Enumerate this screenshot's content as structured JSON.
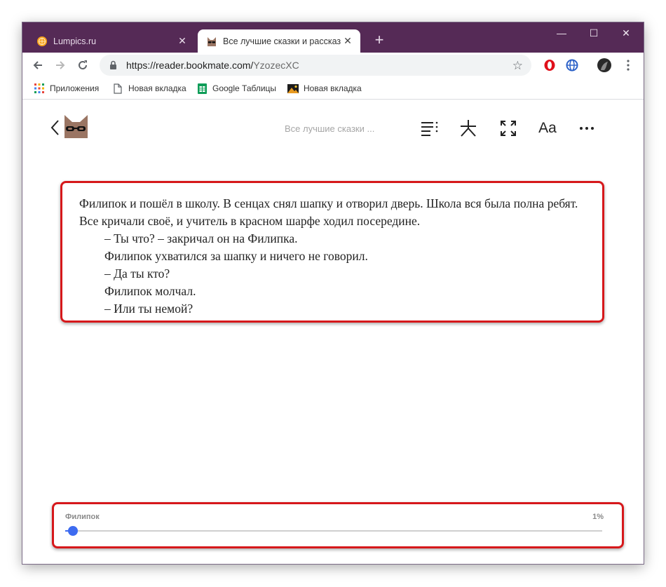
{
  "browser": {
    "tabs": [
      {
        "title": "Lumpics.ru",
        "favicon": "orange-icon",
        "active": false
      },
      {
        "title": "Все лучшие сказки и рассказы.",
        "favicon": "bookmate-cat-icon",
        "active": true
      }
    ],
    "url_host": "https://reader.bookmate.com/",
    "url_path": "YzozecXC",
    "bookmarks": [
      {
        "label": "Приложения",
        "icon": "apps-grid-icon"
      },
      {
        "label": "Новая вкладка",
        "icon": "page-icon"
      },
      {
        "label": "Google Таблицы",
        "icon": "sheets-icon"
      },
      {
        "label": "Новая вкладка",
        "icon": "image-icon"
      }
    ],
    "window_controls": {
      "minimize": "—",
      "maximize": "☐",
      "close": "✕"
    }
  },
  "reader": {
    "book_title": "Все лучшие сказки ...",
    "font_button_label": "Aa",
    "paragraphs": [
      {
        "text": "Филипок и пошёл в школу. В сенцах снял шапку и отворил дверь. Школа вся была полна ребят. Все кричали своё, и учитель в красном шарфе ходил посередине.",
        "indent": false
      },
      {
        "text": "– Ты что? – закричал он на Филипка.",
        "indent": true
      },
      {
        "text": "Филипок ухватился за шапку и ничего не говорил.",
        "indent": true
      },
      {
        "text": "– Да ты кто?",
        "indent": true
      },
      {
        "text": "Филипок молчал.",
        "indent": true
      },
      {
        "text": "– Или ты немой?",
        "indent": true
      }
    ],
    "progress": {
      "chapter": "Филипок",
      "percent_label": "1%",
      "fraction": 0.015
    }
  },
  "colors": {
    "titlebar": "#552a56",
    "highlight_border": "#d6181b",
    "progress_accent": "#3d6bf0"
  }
}
